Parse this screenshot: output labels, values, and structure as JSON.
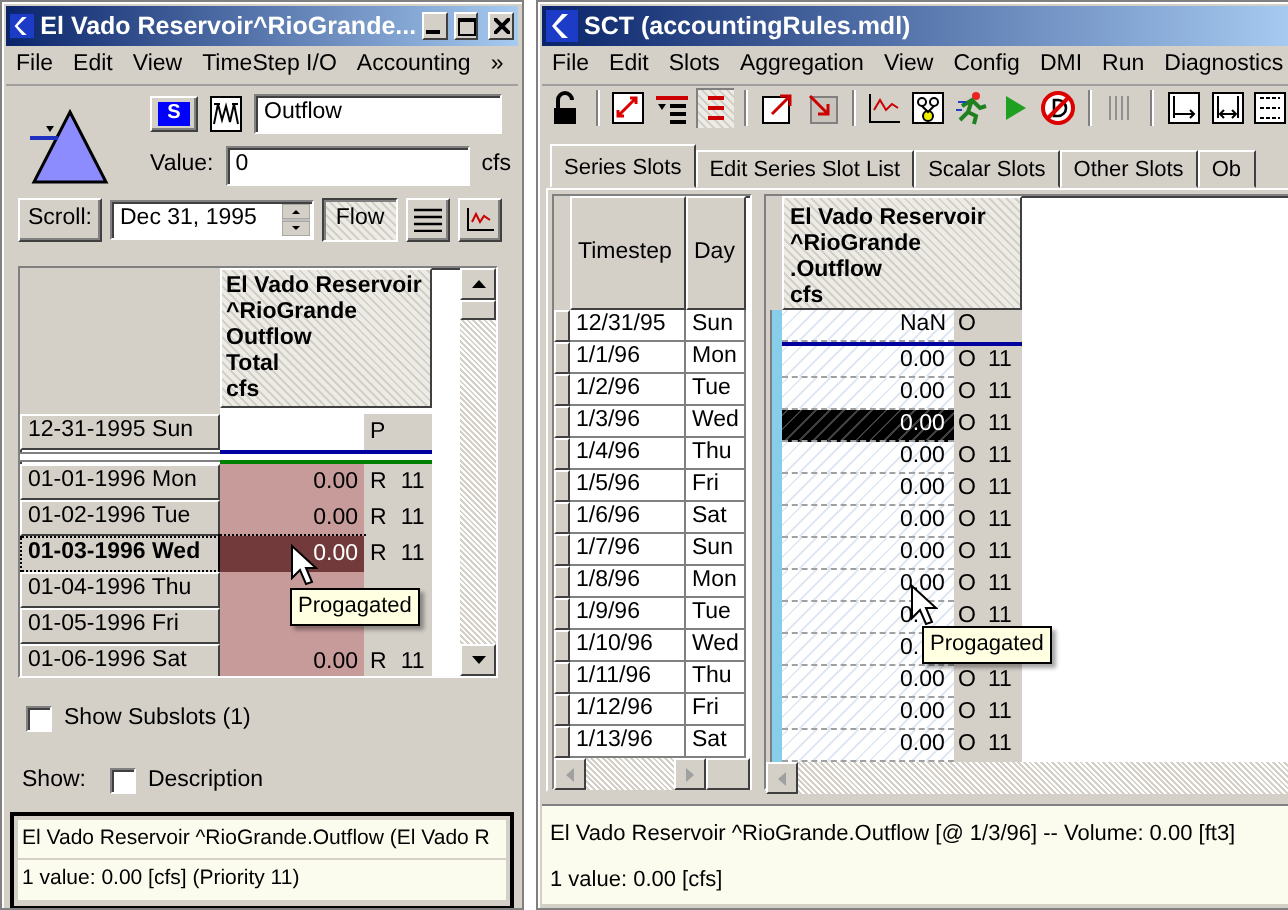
{
  "left_window": {
    "title": "El Vado Reservoir^RioGrande...",
    "menu": [
      "File",
      "Edit",
      "View",
      "TimeStep I/O",
      "Accounting",
      "»"
    ],
    "series_button": "S",
    "slot_name": "Outflow",
    "value_label": "Value:",
    "value": "0",
    "unit": "cfs",
    "scroll_button": "Scroll:",
    "date": "Dec 31, 1995",
    "flow_toggle": {
      "label": "Flow",
      "on": true
    },
    "table": {
      "header": [
        "El Vado Reservoir",
        "^RioGrande",
        "Outflow",
        "Total",
        "cfs"
      ],
      "rows": [
        {
          "date": "12-31-1995 Sun",
          "flag": "P",
          "kind": "initial",
          "selected": false
        },
        {
          "date": "01-01-1996 Mon",
          "value": "0.00",
          "flag": "R",
          "priority": "11",
          "kind": "run",
          "selected": false
        },
        {
          "date": "01-02-1996 Tue",
          "value": "0.00",
          "flag": "R",
          "priority": "11",
          "kind": "run",
          "selected": false
        },
        {
          "date": "01-03-1996 Wed",
          "value": "0.00",
          "flag": "R",
          "priority": "11",
          "kind": "run",
          "selected": true
        },
        {
          "date": "01-04-1996 Thu",
          "kind": "run",
          "selected": false
        },
        {
          "date": "01-05-1996 Fri",
          "kind": "run",
          "selected": false
        },
        {
          "date": "01-06-1996 Sat",
          "value": "0.00",
          "flag": "R",
          "priority": "11",
          "kind": "run",
          "selected": false
        }
      ]
    },
    "tooltip": "Progagated",
    "show_subslots": {
      "label": "Show Subslots (1)",
      "checked": false
    },
    "show_label": "Show:",
    "description": {
      "label": "Description",
      "checked": false
    },
    "status": [
      "El Vado Reservoir ^RioGrande.Outflow (El Vado R",
      "1 value:  0.00 [cfs]  (Priority 11)"
    ]
  },
  "sct_window": {
    "title": "SCT  (accountingRules.mdl)",
    "menu": [
      "File",
      "Edit",
      "Slots",
      "Aggregation",
      "View",
      "Config",
      "DMI",
      "Run",
      "Diagnostics"
    ],
    "tabs": [
      {
        "label": "Series Slots",
        "selected": true
      },
      {
        "label": "Edit Series Slot List",
        "selected": false
      },
      {
        "label": "Scalar Slots",
        "selected": false
      },
      {
        "label": "Other Slots",
        "selected": false
      },
      {
        "label": "Ob",
        "selected": false
      }
    ],
    "table": {
      "columns": [
        "Timestep",
        "Day"
      ],
      "slot_header": [
        "El Vado Reservoir",
        "^RioGrande",
        ".Outflow",
        "cfs"
      ],
      "rows": [
        {
          "timestep": "12/31/95",
          "day": "Sun",
          "value": "NaN",
          "flag": "O",
          "selected": false
        },
        {
          "timestep": "1/1/96",
          "day": "Mon",
          "value": "0.00",
          "flag": "O",
          "priority": "11",
          "selected": false
        },
        {
          "timestep": "1/2/96",
          "day": "Tue",
          "value": "0.00",
          "flag": "O",
          "priority": "11",
          "selected": false
        },
        {
          "timestep": "1/3/96",
          "day": "Wed",
          "value": "0.00",
          "flag": "O",
          "priority": "11",
          "selected": true
        },
        {
          "timestep": "1/4/96",
          "day": "Thu",
          "value": "0.00",
          "flag": "O",
          "priority": "11",
          "selected": false
        },
        {
          "timestep": "1/5/96",
          "day": "Fri",
          "value": "0.00",
          "flag": "O",
          "priority": "11",
          "selected": false
        },
        {
          "timestep": "1/6/96",
          "day": "Sat",
          "value": "0.00",
          "flag": "O",
          "priority": "11",
          "selected": false
        },
        {
          "timestep": "1/7/96",
          "day": "Sun",
          "value": "0.00",
          "flag": "O",
          "priority": "11",
          "selected": false
        },
        {
          "timestep": "1/8/96",
          "day": "Mon",
          "value": "0.00",
          "flag": "O",
          "priority": "11",
          "selected": false
        },
        {
          "timestep": "1/9/96",
          "day": "Tue",
          "value": "0.",
          "flag": "O",
          "priority": "11",
          "selected": false
        },
        {
          "timestep": "1/10/96",
          "day": "Wed",
          "value": "0.",
          "selected": false
        },
        {
          "timestep": "1/11/96",
          "day": "Thu",
          "value": "0.00",
          "flag": "O",
          "priority": "11",
          "selected": false
        },
        {
          "timestep": "1/12/96",
          "day": "Fri",
          "value": "0.00",
          "flag": "O",
          "priority": "11",
          "selected": false
        },
        {
          "timestep": "1/13/96",
          "day": "Sat",
          "value": "0.00",
          "flag": "O",
          "priority": "11",
          "selected": false
        }
      ]
    },
    "tooltip": "Progagated",
    "status": [
      "El Vado Reservoir ^RioGrande.Outflow [@ 1/3/96] -- Volume: 0.00 [ft3]",
      "1 value:  0.00 [cfs]"
    ]
  }
}
